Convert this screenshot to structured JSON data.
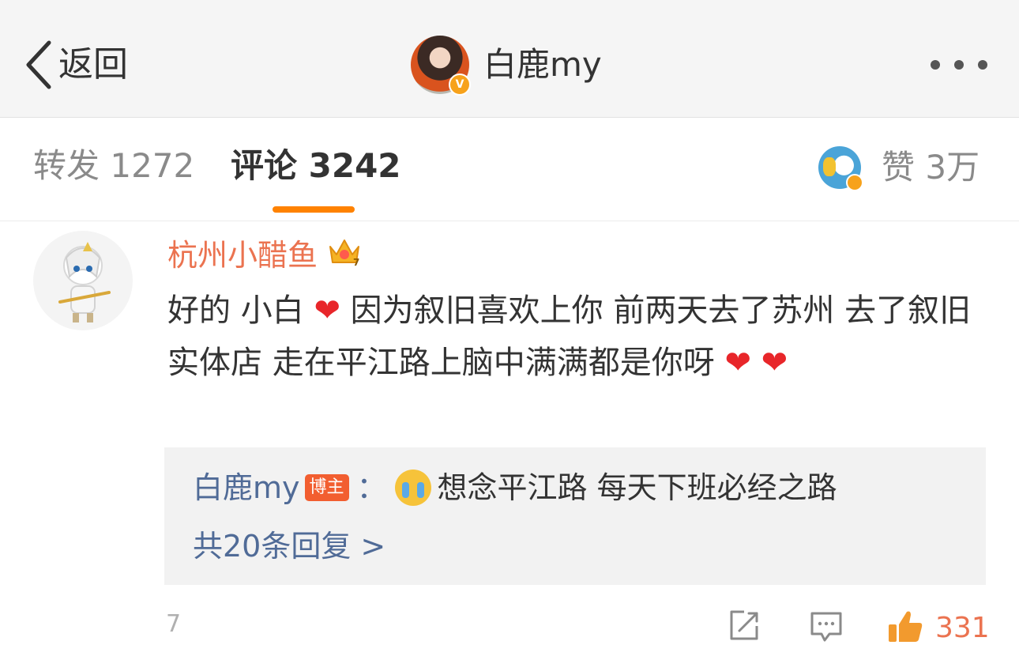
{
  "header": {
    "back_label": "返回",
    "username": "白鹿my",
    "verified_mark": "V"
  },
  "tabs": {
    "repost": "转发 1272",
    "comments": "评论 3242",
    "likes": "赞 3万"
  },
  "comment": {
    "author": "杭州小醋鱼",
    "text_segments": [
      "好的 小白",
      "❤",
      "因为叙旧喜欢上你 前两天去了苏州 去了叙旧实体店 走在平江路上脑中满满都是你呀",
      "❤",
      "❤"
    ],
    "reply": {
      "author": "白鹿my",
      "author_tag": "博主",
      "colon": "：",
      "text": "想念平江路 每天下班必经之路"
    },
    "reply_count": "共20条回复 >",
    "time": "7",
    "like_count": "331"
  },
  "icons": {
    "back": "chevron-left-icon",
    "more": "more-dots-icon",
    "crown": "crown-icon",
    "heart": "heart-icon",
    "cry": "crying-face-icon",
    "repost": "share-icon",
    "comment": "comment-icon",
    "like": "thumbs-up-icon"
  },
  "colors": {
    "accent": "#ff8200",
    "author_name": "#eb7350",
    "link_blue": "#506b97",
    "heart": "#e8262a",
    "author_tag": "#f25e30"
  }
}
